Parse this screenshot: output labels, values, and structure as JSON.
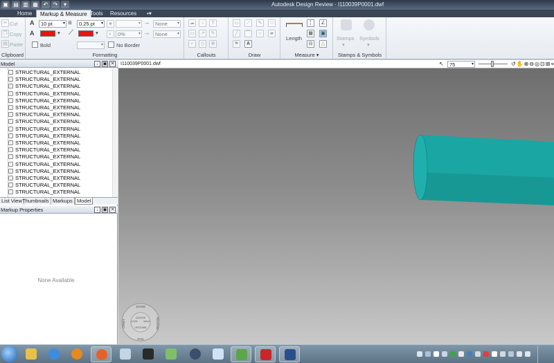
{
  "titlebar": {
    "title": "Autodesk Design Review · I110039P0001.dwf"
  },
  "ribbon": {
    "tabs": [
      {
        "label": "Home"
      },
      {
        "label": "Markup & Measure"
      },
      {
        "label": "Tools"
      },
      {
        "label": "Resources"
      }
    ],
    "clipboard": {
      "cut": "Cut",
      "copy": "Copy",
      "paste": "Paste",
      "label": "Clipboard"
    },
    "formatting": {
      "font_size": "10 pt",
      "line_weight": "0.25 pt",
      "opacity": "0%",
      "none_1": "None",
      "none_2": "None",
      "bold": "Bold",
      "no_border": "No Border",
      "label": "Formatting",
      "fill_color": "#ee1111",
      "line_color": "#ee1111"
    },
    "callouts_label": "Callouts",
    "draw_label": "Draw",
    "measure": {
      "length": "Length",
      "label": "Measure"
    },
    "stamps": {
      "stamps": "Stamps",
      "symbols": "Symbols",
      "label": "Stamps & Symbols"
    }
  },
  "model_panel": {
    "title": "Model",
    "items": [
      "STRUCTURAL_EXTERNAL",
      "STRUCTURAL_EXTERNAL",
      "STRUCTURAL_EXTERNAL",
      "STRUCTURAL_EXTERNAL",
      "STRUCTURAL_EXTERNAL",
      "STRUCTURAL_EXTERNAL",
      "STRUCTURAL_EXTERNAL",
      "STRUCTURAL_EXTERNAL",
      "STRUCTURAL_EXTERNAL",
      "STRUCTURAL_EXTERNAL",
      "STRUCTURAL_EXTERNAL",
      "STRUCTURAL_EXTERNAL",
      "STRUCTURAL_EXTERNAL",
      "STRUCTURAL_EXTERNAL",
      "STRUCTURAL_EXTERNAL",
      "STRUCTURAL_EXTERNAL",
      "STRUCTURAL_EXTERNAL",
      "STRUCTURAL_EXTERNAL"
    ],
    "tabs": [
      {
        "label": "List View"
      },
      {
        "label": "Thumbnails"
      },
      {
        "label": "Markups"
      },
      {
        "label": "Model"
      }
    ]
  },
  "markup_panel": {
    "title": "Markup Properties",
    "empty": "None Available"
  },
  "document": {
    "tab_title": "I110039P0001.dwf",
    "zoom": "75"
  },
  "steering_wheel": {
    "zoom": "ZOOM",
    "pan": "PAN",
    "orbit": "ORBIT",
    "rewind": "REWIND",
    "center": "CENTER",
    "walk": "WALK",
    "up_down": "UP/DOWN",
    "look": "LOOK"
  },
  "colors": {
    "model_cyan": "#1fa3a0"
  }
}
